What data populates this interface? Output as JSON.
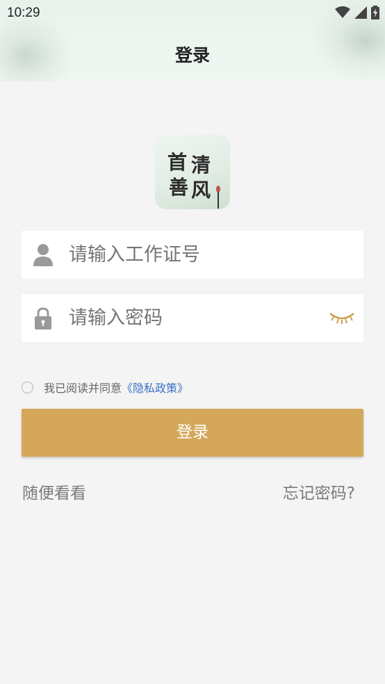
{
  "status_bar": {
    "time": "10:29",
    "icons": [
      "wifi-icon",
      "signal-icon",
      "battery-charging-icon"
    ]
  },
  "header": {
    "title": "登录"
  },
  "logo": {
    "characters": [
      "首",
      "清",
      "善",
      "风"
    ]
  },
  "form": {
    "username": {
      "icon": "user-icon",
      "placeholder": "请输入工作证号",
      "value": ""
    },
    "password": {
      "icon": "lock-icon",
      "placeholder": "请输入密码",
      "value": "",
      "visibility_icon": "eye-closed-icon"
    }
  },
  "agreement": {
    "checked": false,
    "text": "我已阅读并同意",
    "link": "《隐私政策》"
  },
  "login_button": {
    "label": "登录"
  },
  "links": {
    "browse": "随便看看",
    "forgot_password": "忘记密码?"
  },
  "colors": {
    "accent": "#d4a75a",
    "link": "#3a6fc4",
    "background": "#f4f4f4",
    "icon_gray": "#9a9a9a",
    "eye_icon": "#c9a04a"
  }
}
